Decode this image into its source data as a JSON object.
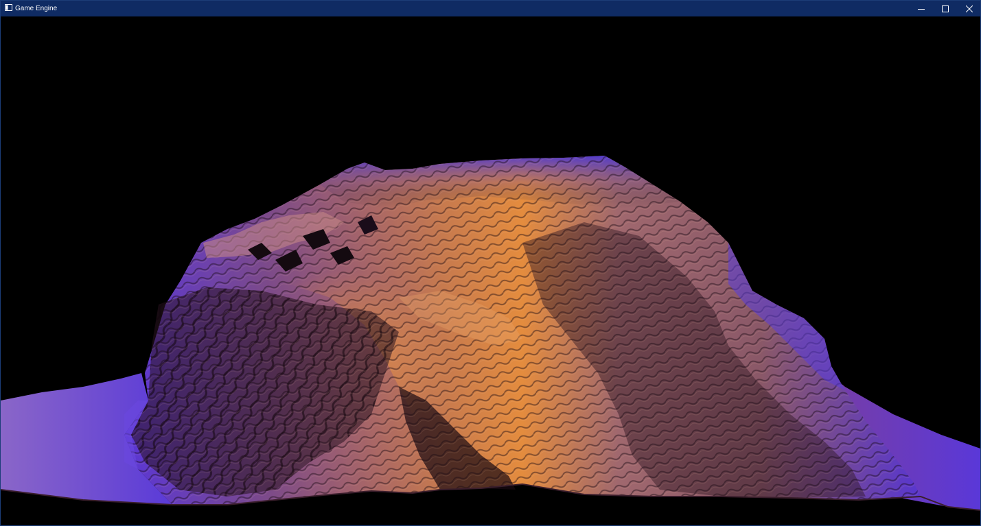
{
  "window": {
    "title": "Game Engine",
    "titlebar_color": "#0f2b63",
    "icons": {
      "app": "app-window-icon",
      "minimize": "minimize-icon",
      "maximize": "maximize-icon",
      "close": "close-icon"
    }
  },
  "scene": {
    "description_type": "3d-terrain-render",
    "background_color": "#000000",
    "palette": {
      "highlight": "#f0943c",
      "mid": "#9a5c6e",
      "shadow": "#2a1420",
      "cool": "#5534d8"
    }
  }
}
